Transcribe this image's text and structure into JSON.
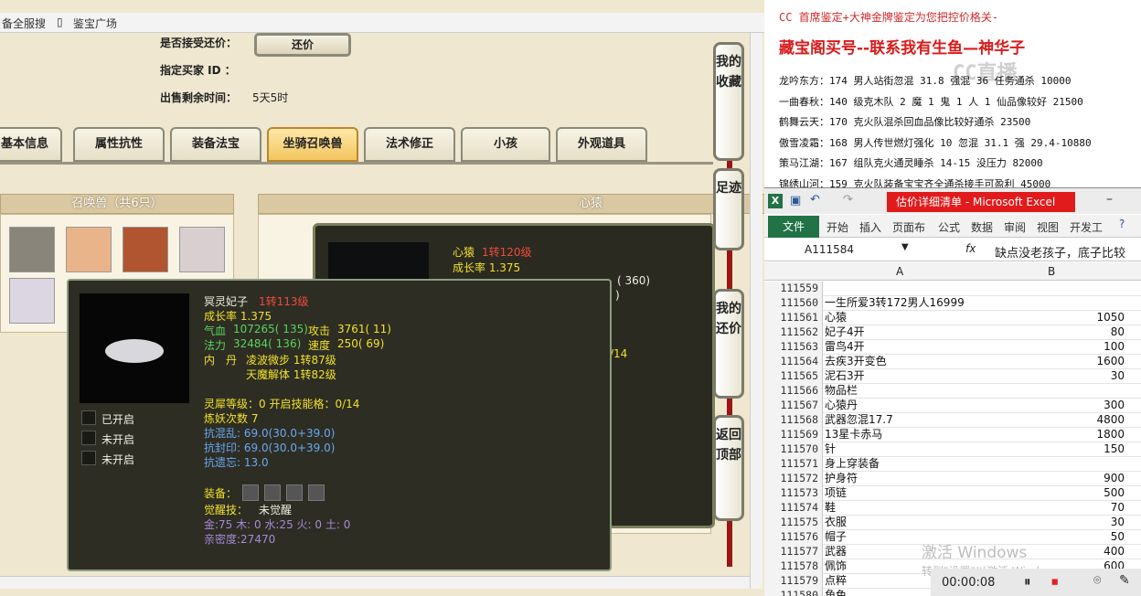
{
  "browser": {
    "bookmarks": [
      "备全服搜",
      "鉴宝广场"
    ]
  },
  "game": {
    "info": {
      "bargain_label": "是否接受还价：",
      "bargain_button": "还价",
      "buyer_label": "指定买家 ID ：",
      "time_label": "出售剩余时间：",
      "time_value": "5天5时"
    },
    "tabs": [
      "基本信息",
      "属性抗性",
      "装备法宝",
      "坐骑召唤兽",
      "法术修正",
      "小孩",
      "外观道具"
    ],
    "pets_header": "召唤兽（共6只）",
    "detail_header": "心猿",
    "side_buttons": [
      "我的收藏",
      "足迹",
      "我的还价",
      "返回顶部"
    ],
    "back_popup": {
      "name": "心猿",
      "level": "1转120级",
      "growth": "成长率 1.375",
      "partial1": "( 360)",
      "partial2": ")",
      "partial3": "/14"
    },
    "popup": {
      "name": "冥灵妃子",
      "level": "1转113级",
      "growth": "成长率 1.375",
      "hp_label": "气血",
      "hp_value": "107265( 135)",
      "atk_label": "攻击",
      "atk_value": "3761( 11)",
      "mp_label": "法力",
      "mp_value": "32484( 136)",
      "spd_label": "速度",
      "spd_value": "250( 69)",
      "dan_label": "内　丹",
      "dan1": "凌波微步 1转87级",
      "dan2": "天魔解体 1转82级",
      "slot1": "已开启",
      "slot2": "未开启",
      "slot3": "未开启",
      "spirit": "灵犀等级：0 开启技能格：0/14",
      "refine": "炼妖次数 7",
      "res1": "抗混乱: 69.0(30.0+39.0)",
      "res2": "抗封印: 69.0(30.0+39.0)",
      "res3": "抗遗忘: 13.0",
      "equip_label": "装备：",
      "awake_label": "觉醒技：",
      "awake_value": "未觉醒",
      "elements": "金:75 木: 0 水:25 火: 0 土: 0",
      "intimacy": "亲密度:27470"
    }
  },
  "doc": {
    "line1": "CC 首席鉴定+大神金牌鉴定为您把控价格关-",
    "headline": "藏宝阁买号--联系我有生鱼—神华子",
    "watermark": "CC直播",
    "entries": [
      "龙吟东方：174 男人站街忽混 31.8 强混 36 任务通杀 10000",
      "一曲春秋：140 级克木队 2 魔 1 鬼 1 人 1 仙品像较好 21500",
      "鹤舞云天：170 克火队混杀回血品像比较好通杀 23500",
      "傲雪凌霜：168 男人传世燃灯强化 10 忽混 31.1 强 29.4-10880",
      "策马江湖：167 组队克火通灵睡杀 14-15 没压力 82000",
      "锦绣山河：159 克火队装备宝宝齐全通杀接手可盈利 45000"
    ]
  },
  "excel": {
    "title": "估价详细清单 - Microsoft Excel",
    "file_tab": "文件",
    "ribbon_tabs": [
      "开始",
      "插入",
      "页面布",
      "公式",
      "数据",
      "审阅",
      "视图",
      "开发工"
    ],
    "name_box": "A111584",
    "fx": "fx",
    "formula": "缺点没老孩子，底子比较",
    "col_a": "A",
    "col_b": "B",
    "rows": [
      {
        "n": "111559",
        "a": "",
        "b": ""
      },
      {
        "n": "111560",
        "a": "一生所爱3转172男人16999",
        "b": ""
      },
      {
        "n": "111561",
        "a": "心猿",
        "b": "1050"
      },
      {
        "n": "111562",
        "a": "妃子4开",
        "b": "80"
      },
      {
        "n": "111563",
        "a": "雷鸟4开",
        "b": "100"
      },
      {
        "n": "111564",
        "a": "去疾3开变色",
        "b": "1600"
      },
      {
        "n": "111565",
        "a": "泥石3开",
        "b": "30"
      },
      {
        "n": "111566",
        "a": "物品栏",
        "b": ""
      },
      {
        "n": "111567",
        "a": "心猿丹",
        "b": "300"
      },
      {
        "n": "111568",
        "a": "武器忽混17.7",
        "b": "4800"
      },
      {
        "n": "111569",
        "a": "13星卡赤马",
        "b": "1800"
      },
      {
        "n": "111570",
        "a": "针",
        "b": "150"
      },
      {
        "n": "111571",
        "a": "身上穿装备",
        "b": ""
      },
      {
        "n": "111572",
        "a": "护身符",
        "b": "900"
      },
      {
        "n": "111573",
        "a": "项链",
        "b": "500"
      },
      {
        "n": "111574",
        "a": "鞋",
        "b": "70"
      },
      {
        "n": "111575",
        "a": "衣服",
        "b": "30"
      },
      {
        "n": "111576",
        "a": "帽子",
        "b": "50"
      },
      {
        "n": "111577",
        "a": "武器",
        "b": "400"
      },
      {
        "n": "111578",
        "a": "佩饰",
        "b": "600"
      },
      {
        "n": "111579",
        "a": "点粹",
        "b": ""
      },
      {
        "n": "111580",
        "a": "角色",
        "b": ""
      }
    ],
    "activate1": "激活 Windows",
    "activate2": "转到\"设置\"以激活 Windows。"
  },
  "recorder": {
    "time": "00:00:08"
  }
}
